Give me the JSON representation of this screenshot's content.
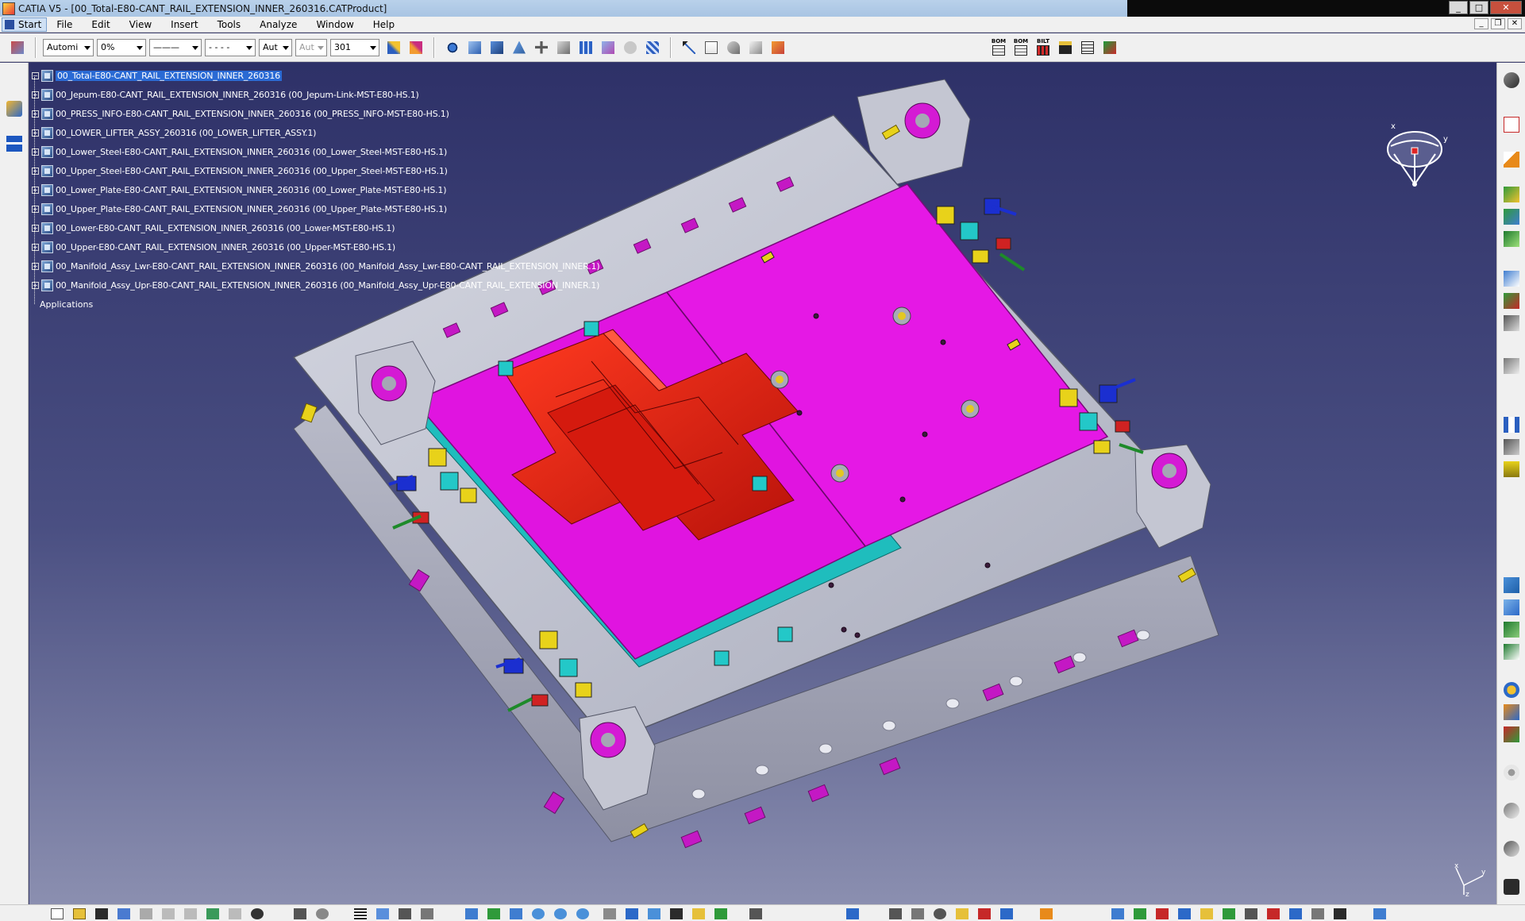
{
  "window": {
    "title": "CATIA V5 - [00_Total-E80-CANT_RAIL_EXTENSION_INNER_260316.CATProduct]",
    "controls": {
      "minimize": "_",
      "maximize": "□",
      "close": "✕"
    }
  },
  "menubar": {
    "start_label": "Start",
    "items": [
      "File",
      "Edit",
      "View",
      "Insert",
      "Tools",
      "Analyze",
      "Window",
      "Help"
    ],
    "mdi_controls": {
      "minimize": "_",
      "restore": "❐",
      "close": "✕"
    }
  },
  "toolbar": {
    "color_combo": "Automi",
    "transparency_combo": "0%",
    "linetype_combo": "———",
    "linethick_combo": "- - - -",
    "pointtype_combo": "Aut",
    "layer_combo_disabled": "Aut",
    "layer_value": "301",
    "bom_labels": [
      "BOM",
      "BOM",
      "BILT"
    ]
  },
  "tree": {
    "root": "00_Total-E80-CANT_RAIL_EXTENSION_INNER_260316",
    "children": [
      "00_Jepum-E80-CANT_RAIL_EXTENSION_INNER_260316 (00_Jepum-Link-MST-E80-HS.1)",
      "00_PRESS_INFO-E80-CANT_RAIL_EXTENSION_INNER_260316 (00_PRESS_INFO-MST-E80-HS.1)",
      "00_LOWER_LIFTER_ASSY_260316 (00_LOWER_LIFTER_ASSY.1)",
      "00_Lower_Steel-E80-CANT_RAIL_EXTENSION_INNER_260316 (00_Lower_Steel-MST-E80-HS.1)",
      "00_Upper_Steel-E80-CANT_RAIL_EXTENSION_INNER_260316 (00_Upper_Steel-MST-E80-HS.1)",
      "00_Lower_Plate-E80-CANT_RAIL_EXTENSION_INNER_260316 (00_Lower_Plate-MST-E80-HS.1)",
      "00_Upper_Plate-E80-CANT_RAIL_EXTENSION_INNER_260316 (00_Upper_Plate-MST-E80-HS.1)",
      "00_Lower-E80-CANT_RAIL_EXTENSION_INNER_260316 (00_Lower-MST-E80-HS.1)",
      "00_Upper-E80-CANT_RAIL_EXTENSION_INNER_260316 (00_Upper-MST-E80-HS.1)",
      "00_Manifold_Assy_Lwr-E80-CANT_RAIL_EXTENSION_INNER_260316 (00_Manifold_Assy_Lwr-E80-CANT_RAIL_EXTENSION_INNER.1)",
      "00_Manifold_Assy_Upr-E80-CANT_RAIL_EXTENSION_INNER_260316 (00_Manifold_Assy_Upr-E80-CANT_RAIL_EXTENSION_INNER.1)"
    ],
    "applications": "Applications"
  },
  "compass": {
    "x_label": "x",
    "y_label": "y"
  },
  "axis_triad": {
    "x_label": "x",
    "y_label": "y",
    "z_label": "z"
  },
  "colors": {
    "viewport_top": "#2e3168",
    "viewport_bottom": "#8b8fb0",
    "die_base": "#c6c8d4",
    "plate": "#e014e0",
    "insert": "#e82010",
    "clamp_cyan": "#23c8c8",
    "clamp_yellow": "#e8d21a",
    "clamp_blue": "#1b2fd0",
    "tree_selection": "#2a6ad4"
  }
}
